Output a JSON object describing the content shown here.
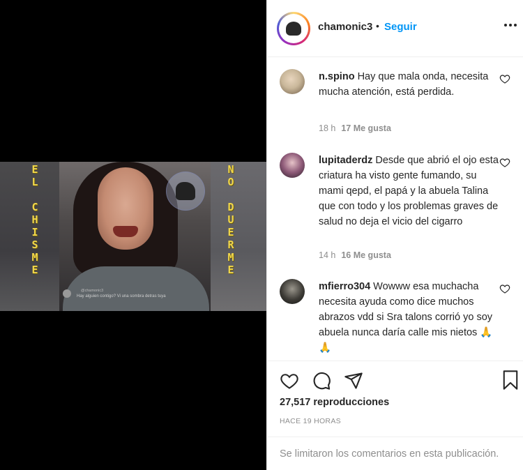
{
  "post": {
    "username": "chamonic3",
    "separator": "•",
    "follow_label": "Seguir",
    "views": "27,517 reproducciones",
    "time_ago": "HACE 19 HORAS",
    "comments_disabled": "Se limitaron los comentarios en esta publicación."
  },
  "video": {
    "left_word": [
      "E",
      "L",
      "",
      "C",
      "H",
      "I",
      "S",
      "M",
      "E"
    ],
    "right_word": [
      "N",
      "O",
      "",
      "D",
      "U",
      "E",
      "R",
      "M",
      "E"
    ],
    "caption": "Hay alguien contigo? Vi una sombra detras tuya",
    "overlay_handle": "@chamonic3"
  },
  "comments": [
    {
      "username": "n.spino",
      "text": "Hay que mala onda, necesita mucha atención, está perdida.",
      "time": "18 h",
      "likes": "17 Me gusta",
      "avatar_color": "#c9b79a"
    },
    {
      "username": "lupitaderdz",
      "text": "Desde que abrió el ojo esta criatura ha visto gente fumando, su mami qepd, el papá y la abuela Talina que con todo y los problemas graves de salud no deja el vicio del cigarro",
      "time": "14 h",
      "likes": "16 Me gusta",
      "avatar_color": "#8e5a78"
    },
    {
      "username": "mfierro304",
      "text": "Wowww esa muchacha necesita ayuda como dice muchos abrazos vdd si Sra talons corrió yo soy abuela nunca daría calle mis nietos 🙏🙏",
      "time": "",
      "likes": "",
      "avatar_color": "#3d3b36"
    }
  ],
  "icons": {
    "like": "heart-icon",
    "comment": "comment-icon",
    "share": "paper-plane-icon",
    "save": "bookmark-icon",
    "more": "more-options-icon"
  },
  "colors": {
    "accent": "#0095f6",
    "text": "#262626",
    "muted": "#8e8e8e",
    "overlay_letters": "#f1d74a"
  }
}
